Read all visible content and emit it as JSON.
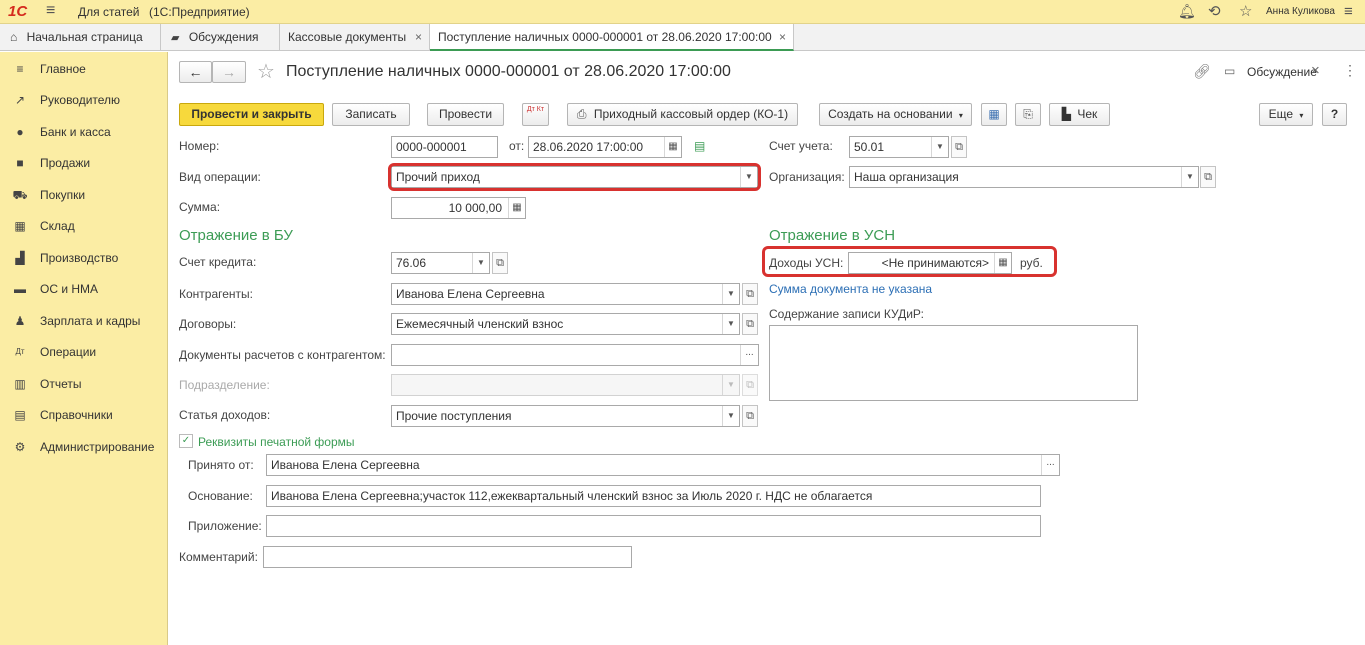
{
  "topbar": {
    "logo": "1С",
    "title": "Для статей",
    "platform": "(1С:Предприятие)",
    "user": "Анна Куликова"
  },
  "tabs": [
    {
      "label": "Начальная страница"
    },
    {
      "label": "Обсуждения"
    },
    {
      "label": "Кассовые документы"
    },
    {
      "label": "Поступление наличных 0000-000001 от 28.06.2020 17:00:00"
    }
  ],
  "sidebar": {
    "items": [
      {
        "label": "Главное",
        "icon": "menu-icon"
      },
      {
        "label": "Руководителю",
        "icon": "trend-icon"
      },
      {
        "label": "Банк и касса",
        "icon": "coin-icon"
      },
      {
        "label": "Продажи",
        "icon": "bag-icon"
      },
      {
        "label": "Покупки",
        "icon": "cart-icon"
      },
      {
        "label": "Склад",
        "icon": "warehouse-icon"
      },
      {
        "label": "Производство",
        "icon": "factory-icon"
      },
      {
        "label": "ОС и НМА",
        "icon": "truck-icon"
      },
      {
        "label": "Зарплата и кадры",
        "icon": "person-icon"
      },
      {
        "label": "Операции",
        "icon": "dt-kt-icon"
      },
      {
        "label": "Отчеты",
        "icon": "chart-icon"
      },
      {
        "label": "Справочники",
        "icon": "book-icon"
      },
      {
        "label": "Администрирование",
        "icon": "gear-icon"
      }
    ]
  },
  "document": {
    "title": "Поступление наличных 0000-000001 от 28.06.2020 17:00:00",
    "discussion_label": "Обсуждение"
  },
  "toolbar": {
    "post_close": "Провести и закрыть",
    "save": "Записать",
    "post": "Провести",
    "dtkt": "Дт Кт",
    "print_ko1": "Приходный кассовый ордер (КО-1)",
    "create_based": "Создать на основании",
    "receipt": "Чек",
    "more": "Еще",
    "help": "?"
  },
  "form": {
    "number_label": "Номер:",
    "number": "0000-000001",
    "date_label": "от:",
    "date": "28.06.2020 17:00:00",
    "account_label": "Счет учета:",
    "account": "50.01",
    "operation_label": "Вид операции:",
    "operation": "Прочий приход",
    "org_label": "Организация:",
    "org": "Наша организация",
    "sum_label": "Сумма:",
    "sum": "10 000,00",
    "section_bu": "Отражение в БУ",
    "section_usn": "Отражение в УСН",
    "credit_label": "Счет кредита:",
    "credit": "76.06",
    "usn_label": "Доходы УСН:",
    "usn_value": "<Не принимаются>",
    "usn_currency": "руб.",
    "usn_note": "Сумма документа не указана",
    "kudir_label": "Содержание записи КУДиР:",
    "kudir": "",
    "contractors_label": "Контрагенты:",
    "contractors": "Иванова Елена Сергеевна",
    "contracts_label": "Договоры:",
    "contracts": "Ежемесячный членский взнос",
    "settlement_label": "Документы расчетов с контрагентом:",
    "settlement": "",
    "division_label": "Подразделение:",
    "division": "",
    "income_item_label": "Статья доходов:",
    "income_item": "Прочие поступления",
    "print_requisites": "Реквизиты печатной формы",
    "accepted_label": "Принято от:",
    "accepted": "Иванова Елена Сергеевна",
    "basis_label": "Основание:",
    "basis": "Иванова Елена Сергеевна;участок 112,ежеквартальный членский взнос за Июль 2020 г. НДС не облагается",
    "attachment_label": "Приложение:",
    "attachment": "",
    "comment_label": "Комментарий:",
    "comment": ""
  },
  "colors": {
    "brand_yellow": "#fbeda4",
    "primary_button": "#f7d93c",
    "section_green": "#3c9c55",
    "highlight_red": "#d8322f",
    "link_blue": "#2c6fb5"
  }
}
